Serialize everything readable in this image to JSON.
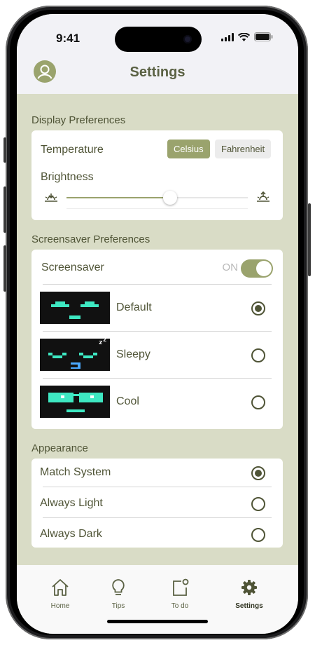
{
  "status_bar": {
    "time": "9:41"
  },
  "header": {
    "title": "Settings"
  },
  "display": {
    "section_label": "Display Preferences",
    "temperature_label": "Temperature",
    "unit_options": [
      "Celsius",
      "Fahrenheit"
    ],
    "selected_unit": "Celsius",
    "brightness_label": "Brightness",
    "brightness_level_percent": 57
  },
  "screensaver": {
    "section_label": "Screensaver Preferences",
    "toggle_label": "Screensaver",
    "toggle_state": "ON",
    "options": [
      {
        "label": "Default",
        "selected": true
      },
      {
        "label": "Sleepy",
        "selected": false
      },
      {
        "label": "Cool",
        "selected": false
      }
    ]
  },
  "appearance": {
    "section_label": "Appearance",
    "options": [
      {
        "label": "Match System",
        "selected": true
      },
      {
        "label": "Always Light",
        "selected": false
      },
      {
        "label": "Always Dark",
        "selected": false
      }
    ]
  },
  "tabbar": {
    "tabs": [
      {
        "label": "Home",
        "icon": "home-icon",
        "active": false
      },
      {
        "label": "Tips",
        "icon": "lightbulb-icon",
        "active": false
      },
      {
        "label": "To do",
        "icon": "todo-icon",
        "active": false
      },
      {
        "label": "Settings",
        "icon": "gear-icon",
        "active": true
      }
    ]
  },
  "colors": {
    "accent": "#9aa36d",
    "background": "#d9dcc6",
    "text": "#4f5436",
    "screensaver_pixel": "#3ee8c2"
  }
}
